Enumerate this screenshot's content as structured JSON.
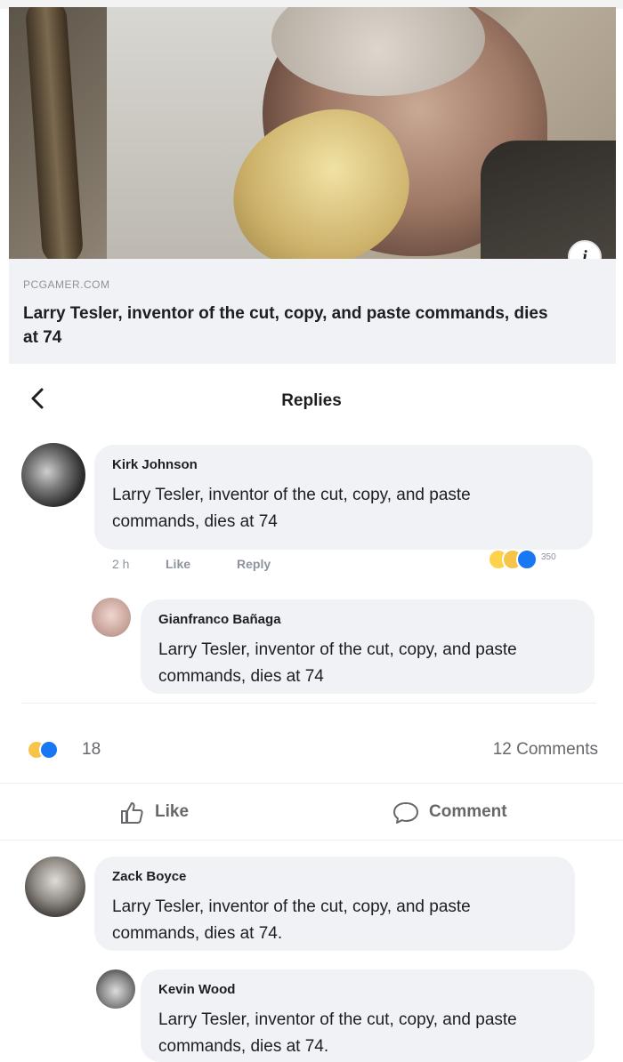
{
  "link_preview": {
    "domain": "PCGAMER.COM",
    "title": "Larry Tesler, inventor of the cut, copy, and paste commands, dies at 74",
    "info_icon": "info-icon"
  },
  "replies_header": {
    "title": "Replies",
    "back_icon": "chevron-left-icon"
  },
  "comments": [
    {
      "author": "Kirk Johnson",
      "text": "Larry Tesler, inventor of the cut, copy, and paste commands, dies at 74",
      "time": "2 h",
      "like_label": "Like",
      "reply_label": "Reply",
      "reaction_count": "350"
    },
    {
      "author": "Gianfranco Bañaga",
      "text": "Larry Tesler, inventor of the cut, copy, and paste commands, dies at 74"
    },
    {
      "author": "Zack Boyce",
      "text": "Larry Tesler, inventor of the cut, copy, and paste commands, dies at 74."
    },
    {
      "author": "Kevin Wood",
      "text": "Larry Tesler, inventor of the cut, copy, and paste commands, dies at 74."
    }
  ],
  "post_summary": {
    "reaction_count": "18",
    "comments_label": "12 Comments"
  },
  "post_actions": {
    "like_label": "Like",
    "comment_label": "Comment"
  },
  "colors": {
    "bubble": "#f0f2f5",
    "secondary_text": "#65676b",
    "like_blue": "#1877f2",
    "haha_yellow": "#f7c44a"
  }
}
